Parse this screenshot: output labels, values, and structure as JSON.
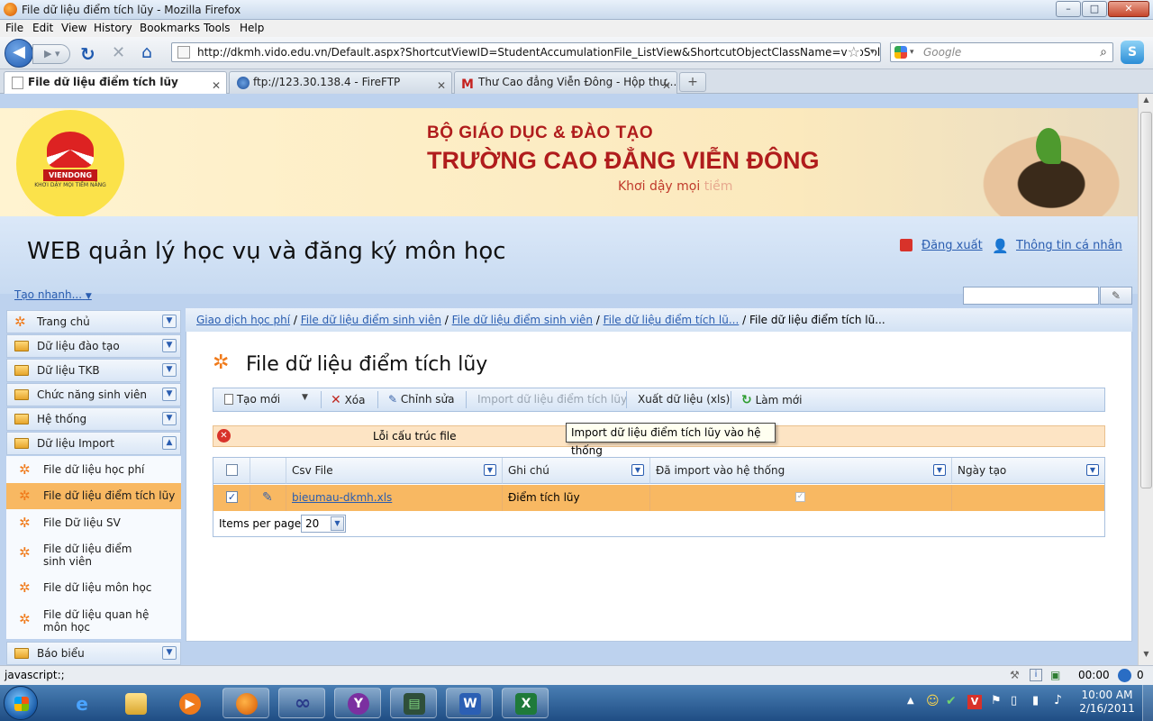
{
  "window": {
    "title": "File dữ liệu điểm tích lũy - Mozilla Firefox",
    "buttons": {
      "minimize": "–",
      "maximize": "□",
      "close": "✕"
    }
  },
  "menu": [
    "File",
    "Edit",
    "View",
    "History",
    "Bookmarks",
    "Tools",
    "Help"
  ],
  "navbar": {
    "url": "http://dkmh.vido.edu.vn/Default.aspx?ShortcutViewID=StudentAccumulationFile_ListView&ShortcutObjectClassName=vidoSolution.Mc",
    "search_placeholder": "Google"
  },
  "tabs": [
    {
      "label": "File dữ liệu điểm tích lũy",
      "active": true
    },
    {
      "label": "ftp://123.30.138.4 - FireFTP",
      "active": false
    },
    {
      "label": "Thư Cao đẳng Viễn Đông - Hộp thư...",
      "active": false
    }
  ],
  "banner": {
    "logo_name": "VIENDONG",
    "logo_slogan": "KHƠI DẬY MỌI TIỀM NĂNG",
    "line1": "BỘ GIÁO DỤC & ĐÀO TẠO",
    "line2": "TRƯỜNG CAO ĐẲNG VIỄN ĐÔNG",
    "tagline_a": "Khơi dậy mọi",
    "tagline_b": "tiềm"
  },
  "header": {
    "site_title": "WEB quản lý học vụ và đăng ký môn học",
    "logout": "Đăng xuất",
    "profile": "Thông tin cá nhân",
    "quick_create": "Tạo nhanh..."
  },
  "sidebar": {
    "items_top": [
      "Trang chủ",
      "Dữ liệu đào tạo",
      "Dữ liệu TKB",
      "Chức năng sinh viên",
      "Hệ thống",
      "Dữ liệu Import"
    ],
    "sub_items": [
      "File dữ liệu học phí",
      "File dữ liệu điểm tích lũy",
      "File Dữ liệu SV",
      "File dữ liệu điểm sinh viên",
      "File dữ liệu môn học",
      "File dữ liệu quan hệ môn học"
    ],
    "item_bottom": "Báo biểu"
  },
  "breadcrumb": {
    "links": [
      "Giao dịch học phí",
      "File dữ liệu điểm sinh viên",
      "File dữ liệu điểm sinh viên",
      "File dữ liệu điểm tích lũ..."
    ],
    "current": "File dữ liệu điểm tích lũ..."
  },
  "main": {
    "title": "File dữ liệu điểm tích lũy",
    "toolbar": {
      "new": "Tạo mới",
      "delete": "Xóa",
      "edit": "Chỉnh sửa",
      "import": "Import dữ liệu điểm tích lũy",
      "export": "Xuất dữ liệu (xls)",
      "refresh": "Làm mới"
    },
    "error": "Lỗi cấu trúc file",
    "tooltip": "Import dữ liệu điểm tích lũy vào hệ thống",
    "grid": {
      "columns": [
        "Csv File",
        "Ghi chú",
        "Đã import vào hệ thống",
        "Ngày tạo"
      ],
      "rows": [
        {
          "csv_file": "bieumau-dkmh.xls",
          "note": "Điểm tích lũy",
          "imported": true,
          "created": ""
        }
      ],
      "items_per_page_label": "Items per page:",
      "items_per_page_value": "20"
    }
  },
  "statusbar": {
    "text": "javascript:;",
    "time": "00:00",
    "count": "0"
  },
  "taskbar": {
    "time": "10:00 AM",
    "date": "2/16/2011"
  },
  "colors": {
    "accent": "#2a5db0",
    "selected_row": "#f8b862",
    "banner_red": "#b01c1c"
  }
}
